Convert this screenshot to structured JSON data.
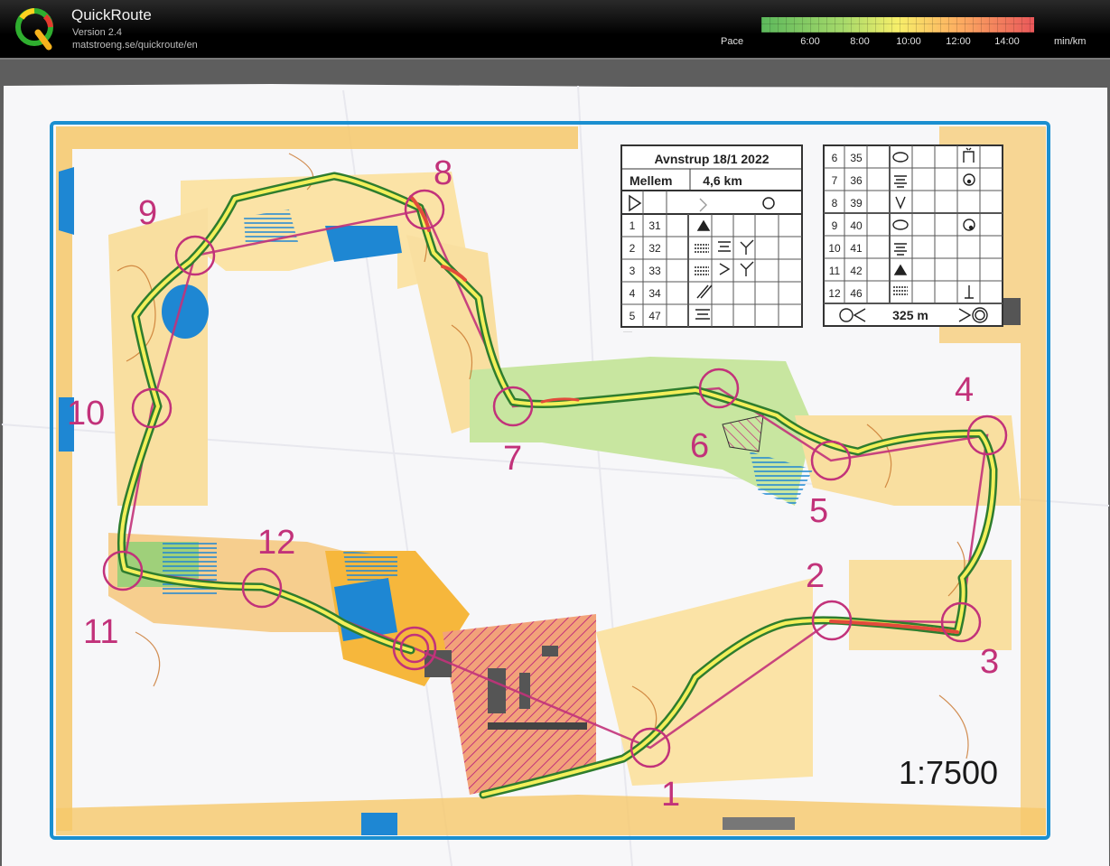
{
  "header": {
    "app_title": "QuickRoute",
    "version": "Version 2.4",
    "url": "matstroeng.se/quickroute/en",
    "pace_label": "Pace",
    "pace_unit": "min/km",
    "pace_ticks": [
      "6:00",
      "8:00",
      "10:00",
      "12:00",
      "14:00"
    ],
    "pace_colors": [
      "#5cb85c",
      "#a6d96a",
      "#f7ef6a",
      "#fdae61",
      "#e9575a"
    ]
  },
  "map": {
    "scale": "1:7500",
    "control_numbers": [
      "1",
      "2",
      "3",
      "4",
      "5",
      "6",
      "7",
      "8",
      "9",
      "10",
      "11",
      "12"
    ],
    "control_description": {
      "event": "Avnstrup 18/1 2022",
      "course": "Mellem",
      "length": "4,6 km",
      "left_rows": [
        {
          "num": "1",
          "code": "31"
        },
        {
          "num": "2",
          "code": "32"
        },
        {
          "num": "3",
          "code": "33"
        },
        {
          "num": "4",
          "code": "34"
        },
        {
          "num": "5",
          "code": "47"
        }
      ],
      "right_rows": [
        {
          "num": "6",
          "code": "35"
        },
        {
          "num": "7",
          "code": "36"
        },
        {
          "num": "8",
          "code": "39"
        },
        {
          "num": "9",
          "code": "40"
        },
        {
          "num": "10",
          "code": "41"
        },
        {
          "num": "11",
          "code": "42"
        },
        {
          "num": "12",
          "code": "46"
        }
      ],
      "finish_distance": "325 m"
    },
    "colors": {
      "course": "#c2327a",
      "frame": "#1b8fd0",
      "route_green": "#2e7d2e",
      "route_yellow": "#f3ef5a",
      "route_red": "#e24b3b",
      "water": "#1e87d3",
      "open_land": "#f6b73c",
      "forest_green": "#a8d57a"
    }
  }
}
